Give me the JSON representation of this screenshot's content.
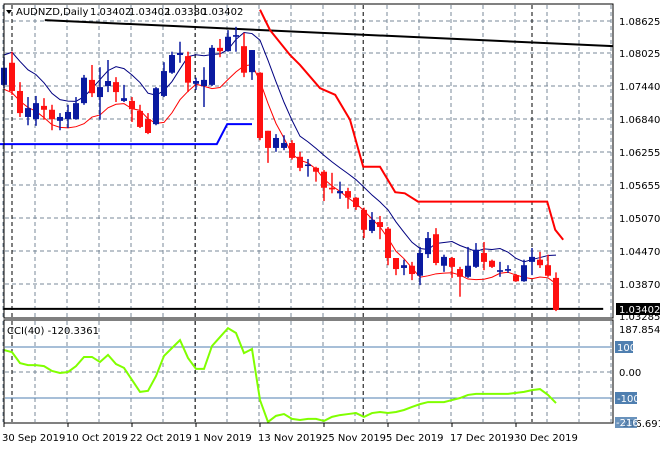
{
  "header": {
    "symbol_label": "AUDNZD,Daily",
    "ohlc": [
      "1.03402",
      "1.03402",
      "1.03380",
      "1.03402"
    ]
  },
  "indicator": {
    "label": "CCI(40) -120.3361",
    "axis_labels": {
      "max": "187.8545",
      "plus100": "100",
      "zero": "0.00",
      "minus100": "-100",
      "min": "-216.6916",
      "min_box": "-216"
    }
  },
  "price_axis": {
    "labels": [
      "1.08625",
      "1.08025",
      "1.07440",
      "1.06840",
      "1.06255",
      "1.05655",
      "1.05070",
      "1.04470",
      "1.03870"
    ],
    "current_price": "1.03402",
    "secondary_price": "1.03285"
  },
  "time_axis": {
    "labels": [
      "30 Sep 2019",
      "10 Oct 2019",
      "22 Oct 2019",
      "1 Nov 2019",
      "13 Nov 2019",
      "25 Nov 2019",
      "5 Dec 2019",
      "17 Dec 2019",
      "30 Dec 2019"
    ]
  },
  "colors": {
    "bull": "#0a1aa0",
    "bear": "#ff1010",
    "cci": "#80ff00",
    "upper_line": "#ff0000",
    "support_step": "#0000ff",
    "level_line": "#4f7fb0"
  },
  "chart_data": {
    "type": "candlestick",
    "price_range": [
      1.0325,
      1.0892
    ],
    "candles": [
      [
        1.0747,
        1.0797,
        1.0741,
        1.0778
      ],
      [
        1.0787,
        1.0807,
        1.0729,
        1.0736
      ],
      [
        1.0736,
        1.0752,
        1.0689,
        1.0696
      ],
      [
        1.0689,
        1.0725,
        1.0674,
        1.0705
      ],
      [
        1.0685,
        1.0727,
        1.0673,
        1.0714
      ],
      [
        1.0709,
        1.0723,
        1.0684,
        1.0702
      ],
      [
        1.0702,
        1.0711,
        1.0665,
        1.0685
      ],
      [
        1.0682,
        1.0696,
        1.0665,
        1.0689
      ],
      [
        1.0685,
        1.0711,
        1.0669,
        1.0698
      ],
      [
        1.0685,
        1.0725,
        1.0684,
        1.0714
      ],
      [
        1.0714,
        1.0765,
        1.0711,
        1.076
      ],
      [
        1.0756,
        1.0783,
        1.0725,
        1.0732
      ],
      [
        1.0725,
        1.0779,
        1.0684,
        1.0743
      ],
      [
        1.0745,
        1.0792,
        1.0734,
        1.0754
      ],
      [
        1.0752,
        1.0761,
        1.0716,
        1.0734
      ],
      [
        1.0718,
        1.0747,
        1.0716,
        1.0723
      ],
      [
        1.0718,
        1.0725,
        1.068,
        1.0703
      ],
      [
        1.07,
        1.0711,
        1.0669,
        1.0671
      ],
      [
        1.0685,
        1.0696,
        1.0658,
        1.066
      ],
      [
        1.0676,
        1.0743,
        1.0674,
        1.0741
      ],
      [
        1.0727,
        1.0788,
        1.0725,
        1.0772
      ],
      [
        1.0769,
        1.0807,
        1.0767,
        1.0801
      ],
      [
        1.0801,
        1.0825,
        1.0787,
        1.0805
      ],
      [
        1.0799,
        1.0807,
        1.0734,
        1.0751
      ],
      [
        1.0749,
        1.076,
        1.0738,
        1.0754
      ],
      [
        1.0745,
        1.0779,
        1.0707,
        1.0756
      ],
      [
        1.0747,
        1.0819,
        1.0745,
        1.0814
      ],
      [
        1.0814,
        1.083,
        1.0797,
        1.0808
      ],
      [
        1.0808,
        1.0846,
        1.0807,
        1.0834
      ],
      [
        1.0834,
        1.0852,
        1.0807,
        1.0837
      ],
      [
        1.0817,
        1.0841,
        1.0761,
        1.0769
      ],
      [
        1.077,
        1.081,
        1.0756,
        1.081
      ],
      [
        1.0769,
        1.077,
        1.0647,
        1.0651
      ],
      [
        1.0664,
        1.0664,
        1.0606,
        1.0633
      ],
      [
        1.0633,
        1.0658,
        1.0626,
        1.0651
      ],
      [
        1.0633,
        1.0656,
        1.0629,
        1.0642
      ],
      [
        1.0642,
        1.0647,
        1.0612,
        1.0615
      ],
      [
        1.0617,
        1.0626,
        1.0591,
        1.0597
      ],
      [
        1.0601,
        1.0613,
        1.0581,
        1.0603
      ],
      [
        1.0597,
        1.0599,
        1.0572,
        1.059
      ],
      [
        1.059,
        1.0593,
        1.0537,
        1.0561
      ],
      [
        1.0561,
        1.0588,
        1.0551,
        1.0558
      ],
      [
        1.0551,
        1.0572,
        1.0541,
        1.0555
      ],
      [
        1.0555,
        1.0561,
        1.0523,
        1.0543
      ],
      [
        1.0543,
        1.0544,
        1.0521,
        1.0526
      ],
      [
        1.0521,
        1.0525,
        1.047,
        1.0485
      ],
      [
        1.0483,
        1.0517,
        1.0479,
        1.0503
      ],
      [
        1.0499,
        1.051,
        1.0468,
        1.049
      ],
      [
        1.0487,
        1.049,
        1.0421,
        1.0434
      ],
      [
        1.0434,
        1.0434,
        1.0403,
        1.0414
      ],
      [
        1.0416,
        1.0431,
        1.0403,
        1.0421
      ],
      [
        1.042,
        1.0427,
        1.0394,
        1.0405
      ],
      [
        1.0402,
        1.0454,
        1.0385,
        1.0443
      ],
      [
        1.0441,
        1.0481,
        1.0434,
        1.047
      ],
      [
        1.0477,
        1.0488,
        1.0421,
        1.0425
      ],
      [
        1.042,
        1.044,
        1.0409,
        1.0436
      ],
      [
        1.0434,
        1.0436,
        1.0398,
        1.0418
      ],
      [
        1.0414,
        1.0418,
        1.0364,
        1.04
      ],
      [
        1.04,
        1.0454,
        1.0398,
        1.042
      ],
      [
        1.0418,
        1.0461,
        1.0416,
        1.0449
      ],
      [
        1.0443,
        1.0463,
        1.0412,
        1.0427
      ],
      [
        1.0429,
        1.0431,
        1.0416,
        1.0418
      ],
      [
        1.0409,
        1.0427,
        1.04,
        1.0412
      ],
      [
        1.0411,
        1.0421,
        1.0407,
        1.0414
      ],
      [
        1.0403,
        1.0405,
        1.0391,
        1.0392
      ],
      [
        1.0392,
        1.0431,
        1.0391,
        1.0421
      ],
      [
        1.0427,
        1.0452,
        1.0403,
        1.0436
      ],
      [
        1.0431,
        1.0445,
        1.0416,
        1.0421
      ],
      [
        1.0421,
        1.044,
        1.04,
        1.0402
      ],
      [
        1.0398,
        1.0408,
        1.0338,
        1.03402
      ]
    ],
    "trendline_top": [
      [
        5.1,
        1.0864
      ],
      [
        76.1,
        1.0817
      ]
    ],
    "support_line": [
      [
        -0.1,
        1.0342
      ],
      [
        74.9,
        1.0342
      ]
    ],
    "upper_channel": [
      [
        32,
        1.0883
      ],
      [
        33.25,
        1.0846
      ],
      [
        35.75,
        1.0801
      ],
      [
        37,
        1.0783
      ],
      [
        39.5,
        1.0741
      ],
      [
        41.4,
        1.0729
      ],
      [
        43.25,
        1.0684
      ],
      [
        44.9,
        1.0599
      ],
      [
        47,
        1.0599
      ],
      [
        48.9,
        1.0553
      ],
      [
        50.1,
        1.0551
      ],
      [
        51.75,
        1.0536
      ],
      [
        67.9,
        1.0536
      ],
      [
        68.9,
        1.0485
      ],
      [
        69.9,
        1.0467
      ]
    ],
    "support_step": [
      [
        -0.5,
        1.064
      ],
      [
        26.6,
        1.064
      ],
      [
        27.9,
        1.0676
      ],
      [
        31,
        1.0676
      ]
    ],
    "cci": {
      "period": 40,
      "range": [
        -216.6916,
        187.8545
      ],
      "levels": [
        100,
        0,
        -100
      ],
      "values": [
        88,
        80,
        37,
        29,
        29,
        25,
        6,
        -2,
        2,
        25,
        61,
        61,
        41,
        69,
        33,
        18,
        -29,
        -76,
        -72,
        -14,
        65,
        96,
        127,
        57,
        14,
        14,
        104,
        139,
        174,
        155,
        76,
        92,
        -108,
        -194,
        -170,
        -163,
        -182,
        -186,
        -182,
        -182,
        -190,
        -174,
        -167,
        -163,
        -159,
        -174,
        -159,
        -155,
        -159,
        -155,
        -147,
        -135,
        -124,
        -116,
        -116,
        -116,
        -108,
        -100,
        -88,
        -84,
        -84,
        -84,
        -84,
        -84,
        -80,
        -76,
        -69,
        -65,
        -88,
        -120
      ]
    },
    "time_label_indices": [
      0,
      8,
      16,
      24,
      32,
      40,
      48,
      56,
      64
    ]
  }
}
